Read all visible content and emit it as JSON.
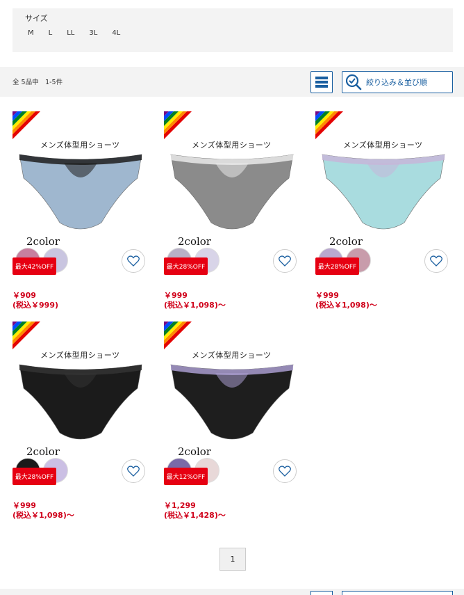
{
  "size_filter": {
    "title": "サイズ",
    "options": [
      "M",
      "L",
      "LL",
      "3L",
      "4L"
    ]
  },
  "result_bar": {
    "count_text": "全 5品中　1-5件",
    "filter_label": "絞り込み＆並び順"
  },
  "products": [
    {
      "title": "メンズ体型用ショーツ",
      "color_count": "2color",
      "discount": "最大42%OFF",
      "price": "￥909",
      "price_tax": "(税込￥999)",
      "body_color": "#9fb7cf",
      "accent_color": "#1f1f1f",
      "swatches": [
        "#c77f9f",
        "#c9c5e0"
      ]
    },
    {
      "title": "メンズ体型用ショーツ",
      "color_count": "2color",
      "discount": "最大28%OFF",
      "price": "￥999",
      "price_tax": "(税込￥1,098)〜",
      "body_color": "#8b8b8b",
      "accent_color": "#e9e9e9",
      "swatches": [
        "#b8b1c6",
        "#d8d4e8"
      ]
    },
    {
      "title": "メンズ体型用ショーツ",
      "color_count": "2color",
      "discount": "最大28%OFF",
      "price": "￥999",
      "price_tax": "(税込￥1,098)〜",
      "body_color": "#a9dcdf",
      "accent_color": "#c7b6d9",
      "swatches": [
        "#b9a8cf",
        "#c89cab"
      ]
    },
    {
      "title": "メンズ体型用ショーツ",
      "color_count": "2color",
      "discount": "最大28%OFF",
      "price": "￥999",
      "price_tax": "(税込￥1,098)〜",
      "body_color": "#1b1b1b",
      "accent_color": "#333333",
      "swatches": [
        "#1a1a1a",
        "#cbbfe4"
      ]
    },
    {
      "title": "メンズ体型用ショーツ",
      "color_count": "2color",
      "discount": "最大12%OFF",
      "price": "￥1,299",
      "price_tax": "(税込￥1,428)〜",
      "body_color": "#1e1e1e",
      "accent_color": "#a99ccf",
      "swatches": [
        "#7a6aa8",
        "#e8d8d8"
      ]
    }
  ],
  "pagination": {
    "current": "1"
  },
  "colors": {
    "accent": "#1a5fa0",
    "price": "#d0021b",
    "badge": "#e60012"
  }
}
